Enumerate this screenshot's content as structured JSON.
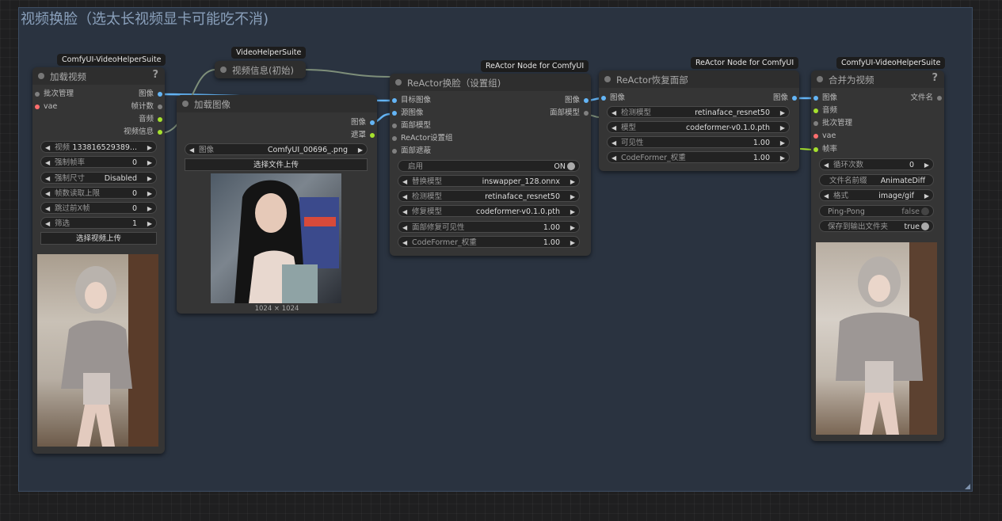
{
  "group": {
    "title": "视频换脸（选太长视频显卡可能吃不消)"
  },
  "load_video": {
    "badge": "ComfyUI-VideoHelperSuite",
    "title": "加载视频",
    "help": "?",
    "inputs": [
      "批次管理",
      "vae"
    ],
    "outputs": [
      "图像",
      "帧计数",
      "音频",
      "视频信息"
    ],
    "widgets": [
      {
        "label": "视频",
        "value": "133816529389..."
      },
      {
        "label": "强制帧率",
        "value": "0"
      },
      {
        "label": "强制尺寸",
        "value": "Disabled"
      },
      {
        "label": "帧数读取上限",
        "value": "0"
      },
      {
        "label": "跳过前X帧",
        "value": "0"
      },
      {
        "label": "筛选",
        "value": "1"
      }
    ],
    "upload_label": "选择视频上传"
  },
  "video_info": {
    "badge": "VideoHelperSuite",
    "title": "视频信息(初始)"
  },
  "load_image": {
    "title": "加载图像",
    "outputs": [
      "图像",
      "遮罩"
    ],
    "widget": {
      "label": "图像",
      "value": "ComfyUI_00696_.png"
    },
    "upload_label": "选择文件上传",
    "caption": "1024 × 1024"
  },
  "reactor_swap": {
    "badge": "ReActor Node for ComfyUI",
    "title": "ReActor换脸（设置组)",
    "inputs": [
      "目标图像",
      "源图像",
      "面部模型",
      "ReActor设置组",
      "面部遮蔽"
    ],
    "outputs": [
      "图像",
      "面部模型"
    ],
    "toggle": {
      "label": "启用",
      "value": "ON"
    },
    "widgets": [
      {
        "label": "替换模型",
        "value": "inswapper_128.onnx"
      },
      {
        "label": "检测模型",
        "value": "retinaface_resnet50"
      },
      {
        "label": "修复模型",
        "value": "codeformer-v0.1.0.pth"
      },
      {
        "label": "面部修复可见性",
        "value": "1.00"
      },
      {
        "label": "CodeFormer_权重",
        "value": "1.00"
      }
    ]
  },
  "reactor_restore": {
    "badge": "ReActor Node for ComfyUI",
    "title": "ReActor恢复面部",
    "input": "图像",
    "output": "图像",
    "widgets": [
      {
        "label": "检测模型",
        "value": "retinaface_resnet50"
      },
      {
        "label": "模型",
        "value": "codeformer-v0.1.0.pth"
      },
      {
        "label": "可见性",
        "value": "1.00"
      },
      {
        "label": "CodeFormer_权重",
        "value": "1.00"
      }
    ]
  },
  "combine": {
    "badge": "ComfyUI-VideoHelperSuite",
    "title": "合并为视频",
    "help": "?",
    "inputs": [
      "图像",
      "音频",
      "批次管理",
      "vae",
      "帧率"
    ],
    "output": "文件名",
    "widgets": [
      {
        "label": "循环次数",
        "value": "0"
      },
      {
        "label": "文件名前缀",
        "value": "AnimateDiff"
      },
      {
        "label": "格式",
        "value": "image/gif"
      }
    ],
    "toggles": [
      {
        "label": "Ping-Pong",
        "value": "false"
      },
      {
        "label": "保存到输出文件夹",
        "value": "true"
      }
    ]
  },
  "colors": {
    "image": "#64b5f6",
    "audio": "#a6e22e",
    "vae": "#ff6e6e",
    "other": "#808080",
    "group": "#2a3340"
  }
}
